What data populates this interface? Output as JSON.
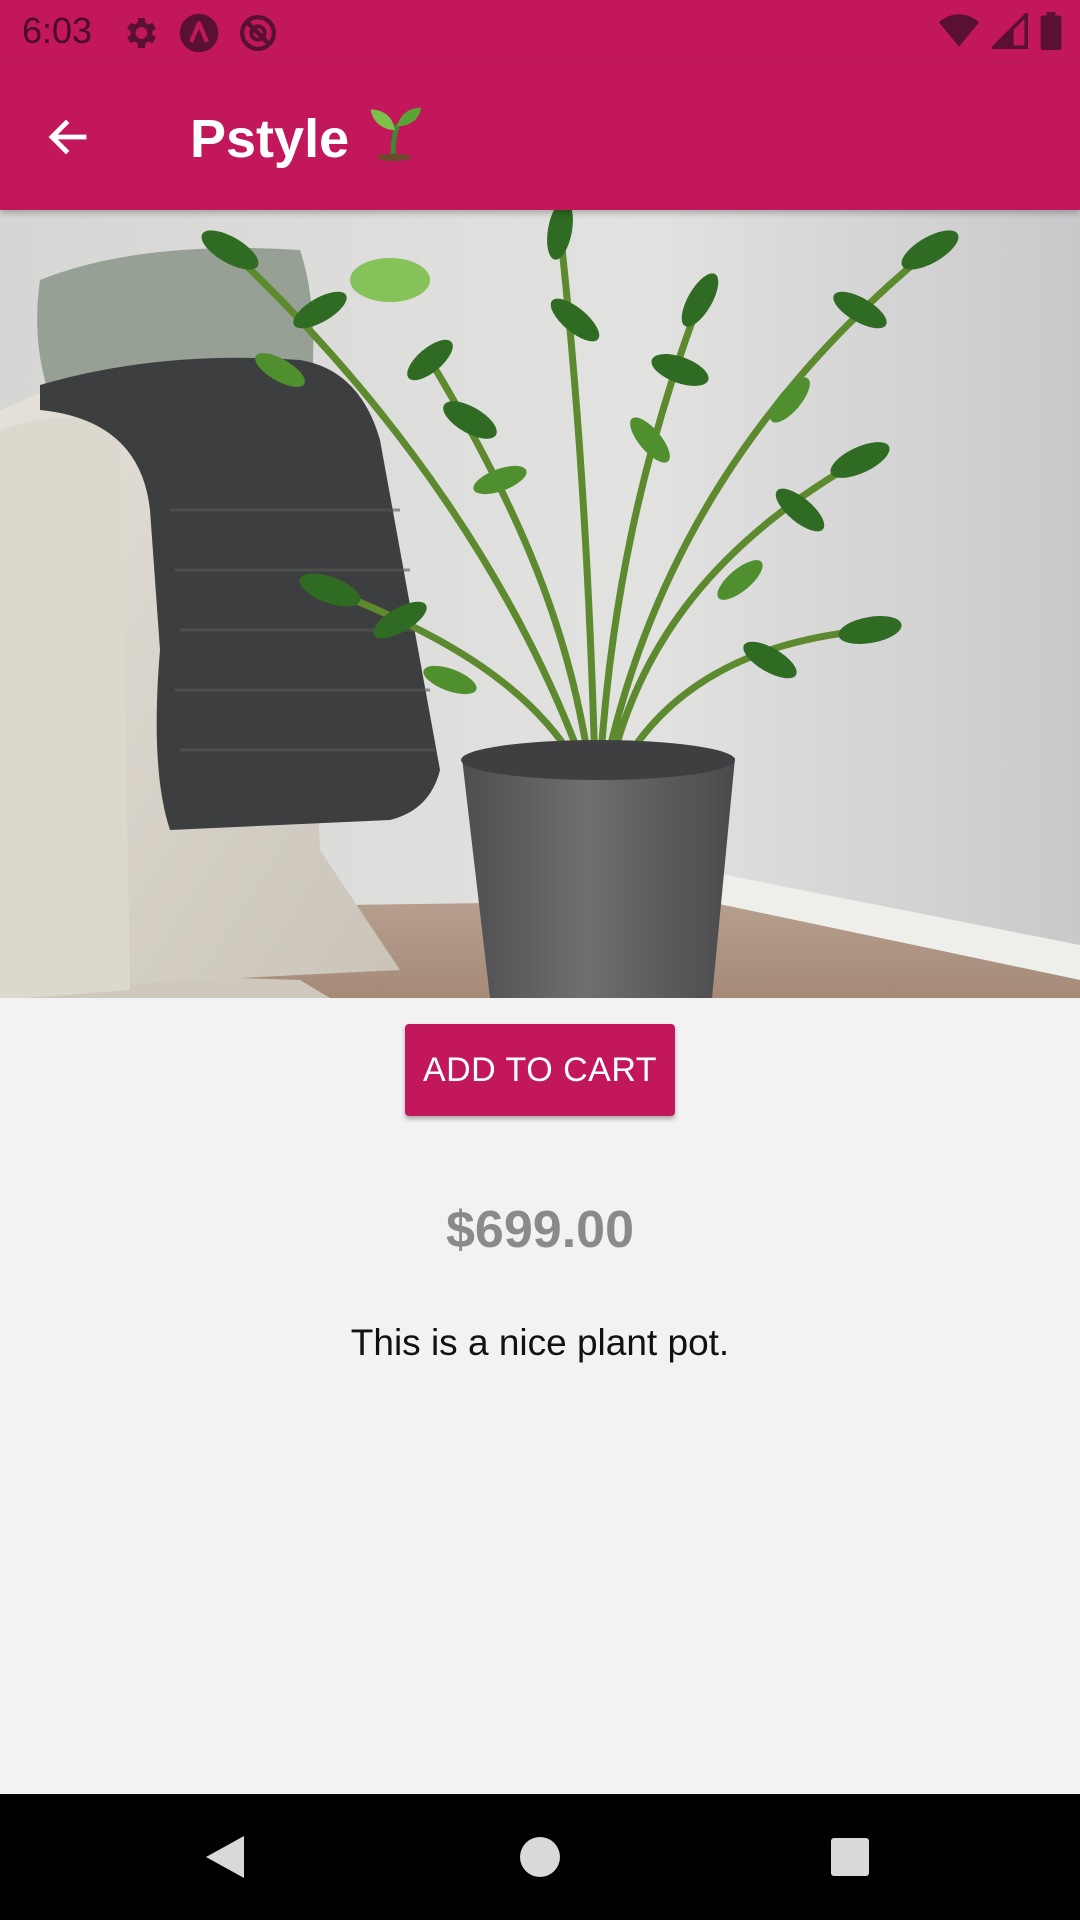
{
  "status_bar": {
    "time": "6:03",
    "left_icons": [
      "settings-icon",
      "app-a-icon",
      "no-disturb-icon"
    ],
    "right_icons": [
      "wifi-icon",
      "signal-icon",
      "battery-icon"
    ]
  },
  "app_bar": {
    "title": "Pstyle",
    "title_emoji": "seedling-icon",
    "back_icon": "arrow-back-icon",
    "color": "#c2185b"
  },
  "product": {
    "image_description": "plant-pot-photo",
    "add_to_cart_label": "ADD TO CART",
    "price": "$699.00",
    "description": "This is a nice plant pot."
  },
  "nav_bar": {
    "buttons": [
      "back-triangle-icon",
      "home-circle-icon",
      "recents-square-icon"
    ]
  },
  "colors": {
    "accent": "#c2185b",
    "background": "#f2f2f2",
    "price_text": "#8a8a8a"
  }
}
